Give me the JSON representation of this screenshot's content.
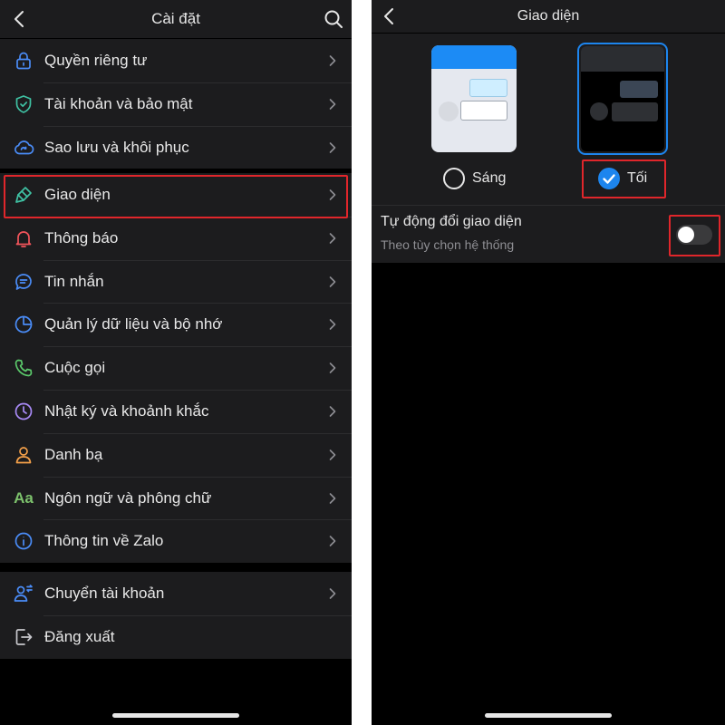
{
  "left": {
    "header": {
      "title": "Cài đặt",
      "back_icon": "chevron-left-icon",
      "search_icon": "search-icon"
    },
    "groups": [
      [
        {
          "label": "Quyền riêng tư",
          "icon": "lock-icon",
          "color": "#4a8cf7"
        },
        {
          "label": "Tài khoản và bảo mật",
          "icon": "shield-icon",
          "color": "#3fc1a3"
        },
        {
          "label": "Sao lưu và khôi phục",
          "icon": "cloud-sync-icon",
          "color": "#4a8cf7"
        }
      ],
      [
        {
          "label": "Giao diện",
          "icon": "paint-brush-icon",
          "color": "#3fc1a3",
          "highlighted": true
        },
        {
          "label": "Thông báo",
          "icon": "bell-icon",
          "color": "#f2545b"
        },
        {
          "label": "Tin nhắn",
          "icon": "chat-bubble-icon",
          "color": "#4a8cf7"
        },
        {
          "label": "Quản lý dữ liệu và bộ nhớ",
          "icon": "pie-chart-icon",
          "color": "#4a8cf7"
        },
        {
          "label": "Cuộc gọi",
          "icon": "phone-icon",
          "color": "#5bc96b"
        },
        {
          "label": "Nhật ký và khoảnh khắc",
          "icon": "clock-icon",
          "color": "#a88af6"
        },
        {
          "label": "Danh bạ",
          "icon": "person-icon",
          "color": "#f5a14a"
        },
        {
          "label": "Ngôn ngữ và phông chữ",
          "icon": "font-aa-icon",
          "color": "#7cc16c",
          "icon_text": "Aa"
        },
        {
          "label": "Thông tin về Zalo",
          "icon": "info-icon",
          "color": "#4a8cf7"
        }
      ],
      [
        {
          "label": "Chuyển tài khoản",
          "icon": "switch-account-icon",
          "color": "#4a8cf7"
        },
        {
          "label": "Đăng xuất",
          "icon": "logout-icon",
          "color": "#c7c7cc",
          "no_chevron": true
        }
      ]
    ]
  },
  "right": {
    "header": {
      "title": "Giao diện",
      "back_icon": "chevron-left-icon"
    },
    "theme": {
      "light_label": "Sáng",
      "dark_label": "Tối",
      "selected": "dark",
      "accent_color": "#1d85ee"
    },
    "auto_switch": {
      "title": "Tự động đổi giao diện",
      "subtitle": "Theo tùy chọn hệ thống",
      "enabled": false
    }
  }
}
